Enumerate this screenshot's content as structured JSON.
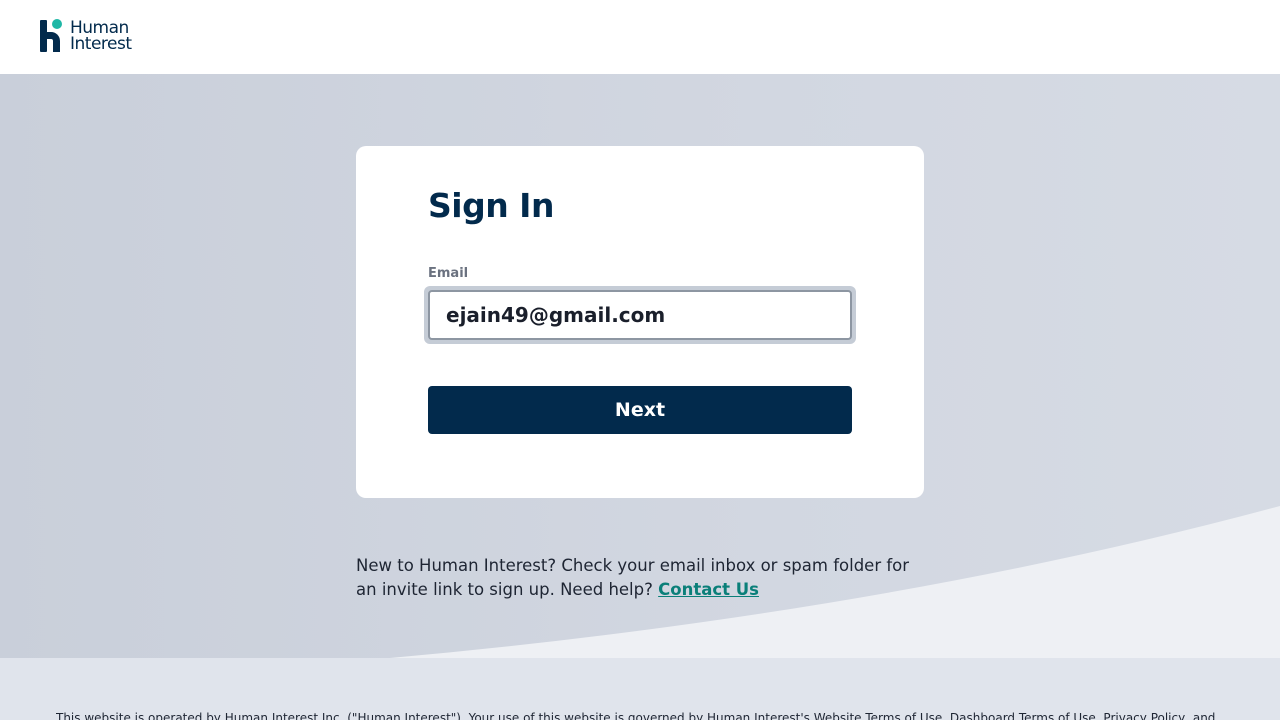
{
  "header": {
    "logo_line1": "Human",
    "logo_line2": "Interest"
  },
  "signin": {
    "title": "Sign In",
    "email_label": "Email",
    "email_value": "ejain49@gmail.com",
    "next_label": "Next"
  },
  "help": {
    "text": "New to Human Interest? Check your email inbox or spam folder for an invite link to sign up. Need help? ",
    "link_label": "Contact Us"
  },
  "footer": {
    "text": "This website is operated by Human Interest Inc. (\"Human Interest\"). Your use of this website is governed by Human Interest's Website Terms of Use, Dashboard Terms of Use, Privacy Policy, and"
  },
  "colors": {
    "brand_navy": "#022a4c",
    "brand_teal": "#1fb7a6",
    "link_teal": "#0a7f79"
  }
}
